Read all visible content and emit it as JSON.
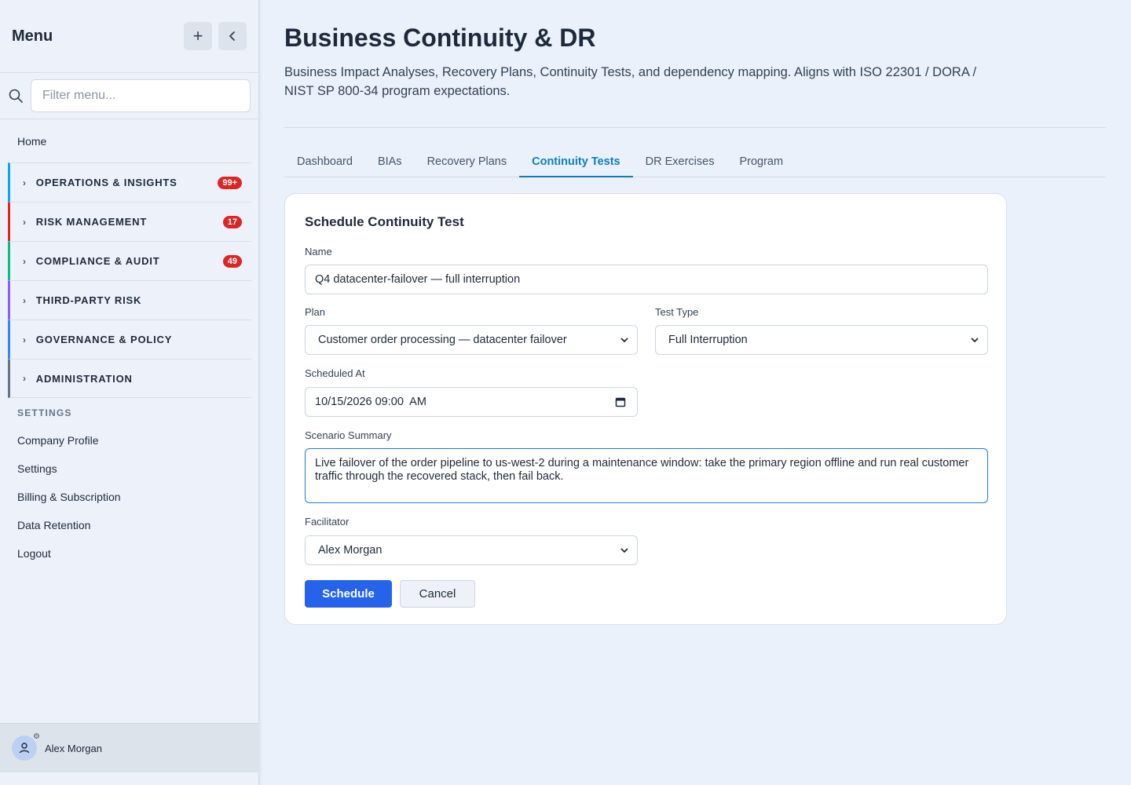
{
  "sidebar": {
    "title": "Menu",
    "add_icon": "plus-icon",
    "collapse_icon": "chevron-left-icon",
    "filter_placeholder": "Filter menu...",
    "home": "Home",
    "sections": [
      {
        "label": "OPERATIONS & INSIGHTS",
        "badge": "99+",
        "color": "#0ea5e9"
      },
      {
        "label": "RISK MANAGEMENT",
        "badge": "17",
        "color": "#dc2626"
      },
      {
        "label": "COMPLIANCE & AUDIT",
        "badge": "49",
        "color": "#10b981"
      },
      {
        "label": "THIRD-PARTY RISK",
        "badge": "",
        "color": "#8b5cf6"
      },
      {
        "label": "GOVERNANCE & POLICY",
        "badge": "",
        "color": "#3b82f6"
      },
      {
        "label": "ADMINISTRATION",
        "badge": "",
        "color": "#64748b"
      }
    ],
    "settings_heading": "SETTINGS",
    "settings_items": [
      "Company Profile",
      "Settings",
      "Billing & Subscription",
      "Data Retention",
      "Logout"
    ],
    "user_name": "Alex Morgan"
  },
  "page": {
    "title": "Business Continuity & DR",
    "description": "Business Impact Analyses, Recovery Plans, Continuity Tests, and dependency mapping. Aligns with ISO 22301 / DORA / NIST SP 800-34 program expectations."
  },
  "tabs": [
    {
      "label": "Dashboard",
      "active": false
    },
    {
      "label": "BIAs",
      "active": false
    },
    {
      "label": "Recovery Plans",
      "active": false
    },
    {
      "label": "Continuity Tests",
      "active": true
    },
    {
      "label": "DR Exercises",
      "active": false
    },
    {
      "label": "Program",
      "active": false
    }
  ],
  "form": {
    "title": "Schedule Continuity Test",
    "name_label": "Name",
    "name_value": "Q4 datacenter-failover — full interruption",
    "plan_label": "Plan",
    "plan_value": "Customer order processing — datacenter failover",
    "test_type_label": "Test Type",
    "test_type_value": "Full Interruption",
    "scheduled_label": "Scheduled At",
    "scheduled_value": "10/15/2026 09:00  AM",
    "summary_label": "Scenario Summary",
    "summary_value": "Live failover of the order pipeline to us-west-2 during a maintenance window: take the primary region offline and run real customer traffic through the recovered stack, then fail back.",
    "facilitator_label": "Facilitator",
    "facilitator_value": "Alex Morgan",
    "schedule_button": "Schedule",
    "cancel_button": "Cancel"
  }
}
